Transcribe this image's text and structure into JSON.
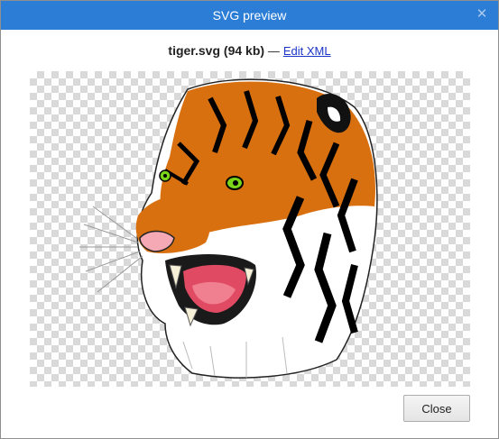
{
  "dialog": {
    "title": "SVG preview",
    "close_glyph": "✕"
  },
  "file": {
    "name": "tiger.svg",
    "size": "(94 kb)",
    "separator": "—",
    "edit_link": "Edit XML"
  },
  "preview": {
    "image_subject": "tiger-head-illustration",
    "colors": {
      "checker_light": "#ffffff",
      "checker_dark": "#d9d9d9",
      "fur_orange": "#d9700f",
      "stripe": "#000000",
      "eye": "#7bd41a",
      "mouth": "#e04a63"
    }
  },
  "footer": {
    "close_label": "Close"
  },
  "colors": {
    "titlebar": "#2b7dd6",
    "link": "#1a35c8"
  }
}
